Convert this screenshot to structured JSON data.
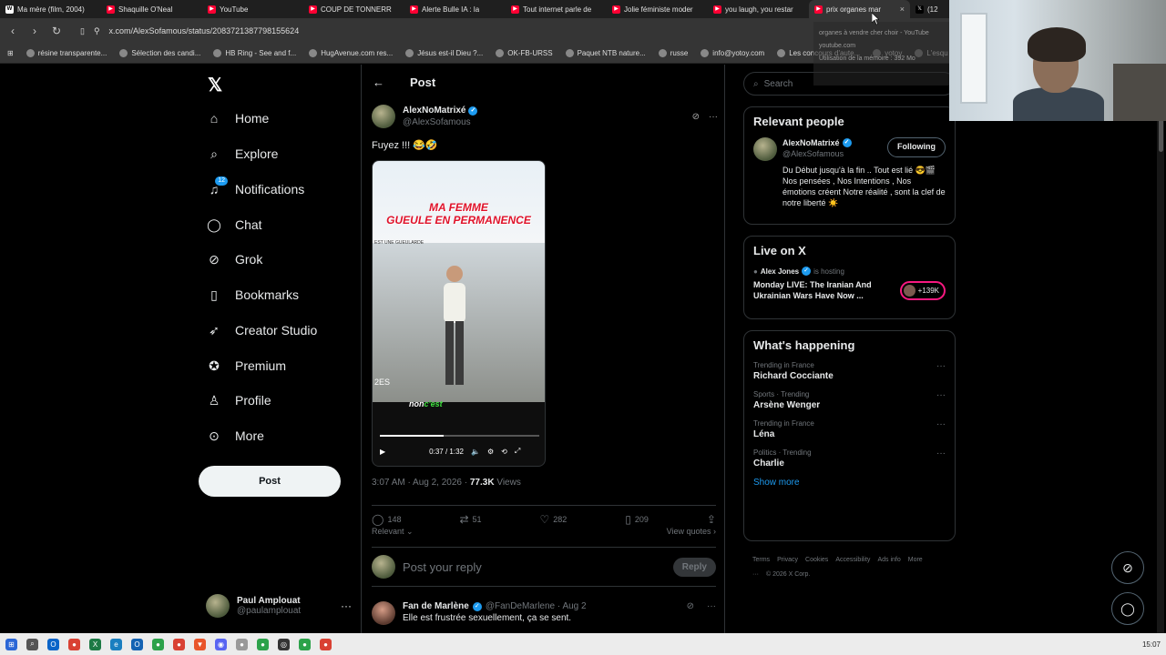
{
  "browser": {
    "tabs": [
      {
        "label": "Ma mère (film, 2004)",
        "fav": "W",
        "type": "wiki",
        "active": false
      },
      {
        "label": "Shaquille O'Neal",
        "fav": "▶",
        "type": "yt",
        "active": false
      },
      {
        "label": "YouTube",
        "fav": "▶",
        "type": "yt",
        "active": false
      },
      {
        "label": "COUP DE TONNERR",
        "fav": "▶",
        "type": "yt",
        "active": false
      },
      {
        "label": "Alerte Bulle IA : la",
        "fav": "▶",
        "type": "yt",
        "active": false
      },
      {
        "label": "Tout internet parle de",
        "fav": "▶",
        "type": "yt",
        "active": false
      },
      {
        "label": "Jolie féministe moder",
        "fav": "▶",
        "type": "yt",
        "active": false
      },
      {
        "label": "you laugh, you restar",
        "fav": "▶",
        "type": "yt",
        "active": false
      },
      {
        "label": "prix organes mar",
        "fav": "▶",
        "type": "yt",
        "active": true
      },
      {
        "label": "(12",
        "fav": "𝕏",
        "type": "x",
        "active": false
      }
    ],
    "close_glyph": "×",
    "url": "x.com/AlexSofamous/status/2083721387798155624",
    "bookmarks": [
      "résine transparente...",
      "Sélection des candi...",
      "HB Ring - See and f...",
      "HugAvenue.com res...",
      "Jésus est-il Dieu ?...",
      "OK-FB-URSS",
      "Paquet NTB nature...",
      "russe",
      "info@yotoy.com",
      "Les concours d'aute...",
      "yotoy",
      "L'esqu"
    ],
    "overlay_lines": [
      "organes à vendre cher choir - YouTube",
      "youtube.com",
      "Utilisation de la mémoire : 392 Mo"
    ]
  },
  "left_nav": {
    "logo": "𝕏",
    "items": [
      {
        "label": "Home",
        "icon": "home-icon",
        "glyph": "⌂"
      },
      {
        "label": "Explore",
        "icon": "search-icon",
        "glyph": "⌕"
      },
      {
        "label": "Notifications",
        "icon": "bell-icon",
        "glyph": "♫",
        "badge": "12"
      },
      {
        "label": "Chat",
        "icon": "chat-icon",
        "glyph": "◯"
      },
      {
        "label": "Grok",
        "icon": "grok-icon",
        "glyph": "⊘"
      },
      {
        "label": "Bookmarks",
        "icon": "bookmark-icon",
        "glyph": "▯"
      },
      {
        "label": "Creator Studio",
        "icon": "rocket-icon",
        "glyph": "➶"
      },
      {
        "label": "Premium",
        "icon": "premium-icon",
        "glyph": "✪"
      },
      {
        "label": "Profile",
        "icon": "profile-icon",
        "glyph": "♙"
      },
      {
        "label": "More",
        "icon": "more-icon",
        "glyph": "⊙"
      }
    ],
    "post_button": "Post",
    "account": {
      "name": "Paul Amplouat",
      "handle": "@paulamplouat",
      "more": "···"
    }
  },
  "post": {
    "header_title": "Post",
    "back_glyph": "←",
    "author_name": "AlexNoMatrixé",
    "author_handle": "@AlexSofamous",
    "verified_glyph": "✓",
    "grok_glyph": "⊘",
    "more_glyph": "···",
    "text": "Fuyez !!! 😂🤣",
    "video": {
      "caption_line1": "MA FEMME",
      "caption_line2": "GUEULE EN PERMANENCE",
      "tagline": "EST UNE GUEULARDE",
      "subtitle_a": "non",
      "subtitle_b": "c'est",
      "watermark": "2ES",
      "time": "0:37 / 1:32",
      "progress": 0.4
    },
    "timestamp": "3:07 AM · Aug 2, 2026 · ",
    "views_count": "77.3K",
    "views_label": " Views",
    "stats": {
      "replies": "148",
      "reposts": "51",
      "likes": "282",
      "bookmarks": "209"
    },
    "sort_label": "Relevant ⌄",
    "quotes_label": "View quotes ›",
    "reply_placeholder": "Post your reply",
    "reply_button": "Reply"
  },
  "reply": {
    "name": "Fan de Marlène",
    "handle": "@FanDeMarlene · Aug 2",
    "text": "Elle est frustrée sexuellement, ça se sent."
  },
  "right_col": {
    "search_placeholder": "Search",
    "relevant_title": "Relevant people",
    "rp_name": "AlexNoMatrixé",
    "rp_handle": "@AlexSofamous",
    "rp_button": "Following",
    "rp_bio": "Du Début jusqu'à la fin .. Tout est lié 😎🎬 Nos pensées , Nos Intentions , Nos émotions créent Notre réalité , sont la clef de notre liberté ☀️",
    "live_title": "Live on X",
    "live_host_name": "Alex Jones",
    "live_host_suffix": "is hosting",
    "live_show": "Monday LIVE: The Iranian And Ukrainian Wars Have Now ...",
    "live_count": "+139K",
    "happening_title": "What's happening",
    "trends": [
      {
        "context": "Trending in France",
        "name": "Richard Cocciante"
      },
      {
        "context": "Sports · Trending",
        "name": "Arsène Wenger"
      },
      {
        "context": "Trending in France",
        "name": "Léna"
      },
      {
        "context": "Politics · Trending",
        "name": "Charlie"
      }
    ],
    "show_more": "Show more",
    "footer_links": [
      "Terms",
      "Privacy",
      "Cookies",
      "Accessibility",
      "Ads info",
      "More ···",
      "© 2026 X Corp."
    ]
  },
  "taskbar": {
    "clock": "15:07",
    "icons": [
      {
        "name": "windows-start-icon",
        "color": "#2b67d6",
        "glyph": "⊞"
      },
      {
        "name": "search-icon",
        "color": "#555555",
        "glyph": "⌕"
      },
      {
        "name": "outlook-icon",
        "color": "#0a64c8",
        "glyph": "O"
      },
      {
        "name": "chrome-icon",
        "color": "#d94133",
        "glyph": "●"
      },
      {
        "name": "excel-icon",
        "color": "#1d7a45",
        "glyph": "X"
      },
      {
        "name": "edge-icon",
        "color": "#1a7fc0",
        "glyph": "e"
      },
      {
        "name": "outlook-2-icon",
        "color": "#1463b3",
        "glyph": "O"
      },
      {
        "name": "chrome-2-icon",
        "color": "#2ca24a",
        "glyph": "●"
      },
      {
        "name": "chrome-3-icon",
        "color": "#d94133",
        "glyph": "●"
      },
      {
        "name": "brave-icon",
        "color": "#e9552a",
        "glyph": "▼"
      },
      {
        "name": "discord-icon",
        "color": "#5865f2",
        "glyph": "◉"
      },
      {
        "name": "chrome-4-icon",
        "color": "#999999",
        "glyph": "●"
      },
      {
        "name": "chrome-5-icon",
        "color": "#2ca24a",
        "glyph": "●"
      },
      {
        "name": "obs-icon",
        "color": "#333333",
        "glyph": "◎"
      },
      {
        "name": "chrome-6-icon",
        "color": "#2ca24a",
        "glyph": "●"
      },
      {
        "name": "chrome-7-icon",
        "color": "#d94133",
        "glyph": "●"
      }
    ]
  },
  "colors": {
    "accent": "#1d9bf0",
    "live": "#f91880",
    "youtube": "#ff0033"
  }
}
